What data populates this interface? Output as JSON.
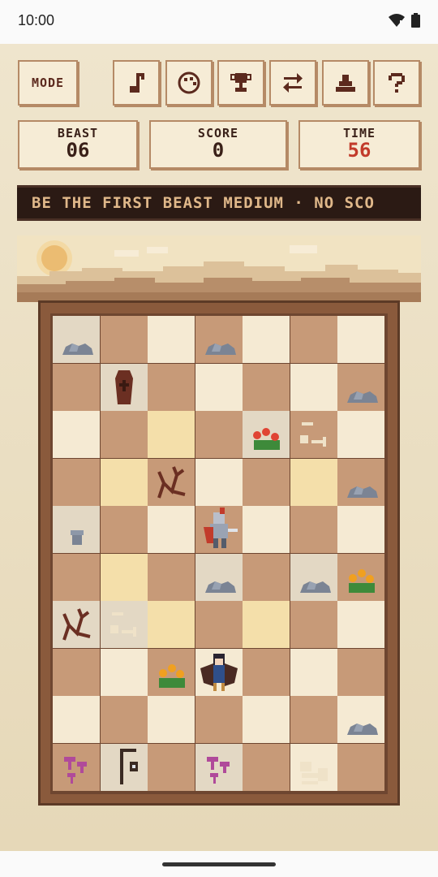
{
  "status": {
    "time": "10:00"
  },
  "toolbar": {
    "mode_label": "MODE",
    "icons": [
      "music-icon",
      "palette-icon",
      "trophy-icon",
      "swap-icon",
      "podium-icon",
      "help-icon"
    ]
  },
  "stats": {
    "beast_label": "BEAST",
    "beast_value": "06",
    "score_label": "SCORE",
    "score_value": "0",
    "time_label": "TIME",
    "time_value": "56"
  },
  "ticker": {
    "text": "BE THE FIRST BEAST MEDIUM · NO SCO"
  },
  "colors": {
    "accent_red": "#c23b2b",
    "frame": "#8a5a3c",
    "panel": "#f6ecd6"
  },
  "board": {
    "columns": 7,
    "rows": 10,
    "pieces": [
      {
        "row": 0,
        "col": 0,
        "item": "rock"
      },
      {
        "row": 0,
        "col": 3,
        "item": "rock"
      },
      {
        "row": 1,
        "col": 1,
        "item": "coffin"
      },
      {
        "row": 1,
        "col": 6,
        "item": "rock"
      },
      {
        "row": 2,
        "col": 4,
        "item": "red-flowers"
      },
      {
        "row": 2,
        "col": 5,
        "item": "bones"
      },
      {
        "row": 3,
        "col": 2,
        "item": "dead-bush"
      },
      {
        "row": 3,
        "col": 6,
        "item": "rock"
      },
      {
        "row": 4,
        "col": 0,
        "item": "gravestone"
      },
      {
        "row": 4,
        "col": 3,
        "item": "knight"
      },
      {
        "row": 5,
        "col": 3,
        "item": "rock"
      },
      {
        "row": 5,
        "col": 5,
        "item": "rock"
      },
      {
        "row": 5,
        "col": 6,
        "item": "yellow-flowers"
      },
      {
        "row": 6,
        "col": 0,
        "item": "dead-bush"
      },
      {
        "row": 6,
        "col": 1,
        "item": "bones"
      },
      {
        "row": 7,
        "col": 2,
        "item": "yellow-flowers"
      },
      {
        "row": 7,
        "col": 3,
        "item": "harpy"
      },
      {
        "row": 8,
        "col": 6,
        "item": "rock"
      },
      {
        "row": 9,
        "col": 0,
        "item": "mushrooms"
      },
      {
        "row": 9,
        "col": 1,
        "item": "lantern-post"
      },
      {
        "row": 9,
        "col": 3,
        "item": "mushrooms"
      },
      {
        "row": 9,
        "col": 5,
        "item": "skeleton"
      }
    ]
  }
}
